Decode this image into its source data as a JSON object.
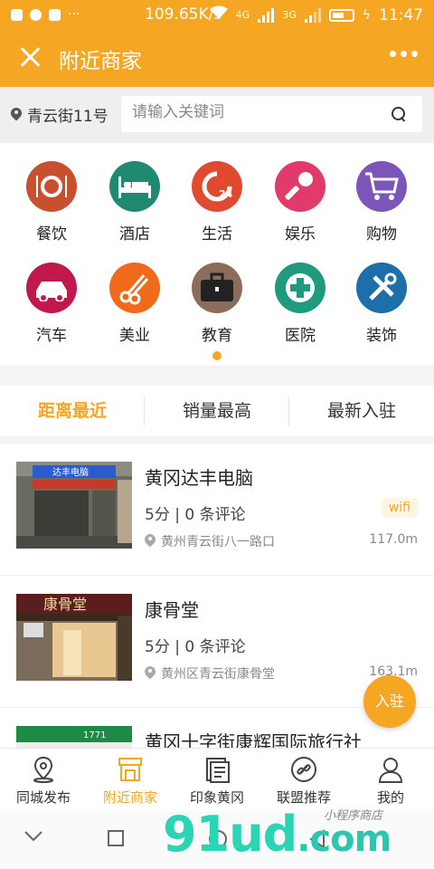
{
  "status_bar": {
    "network_speed": "109.65K/s",
    "signal_4g": "4G",
    "signal_3g": "3G",
    "time": "11:47"
  },
  "header": {
    "title": "附近商家"
  },
  "search": {
    "location": "青云街11号",
    "placeholder": "请输入关键词"
  },
  "categories": [
    {
      "label": "餐饮",
      "icon": "dining-icon",
      "color": "#c9502f"
    },
    {
      "label": "酒店",
      "icon": "hotel-bed-icon",
      "color": "#1f8a70"
    },
    {
      "label": "生活",
      "icon": "24h-service-icon",
      "color": "#e04a2f"
    },
    {
      "label": "娱乐",
      "icon": "microphone-icon",
      "color": "#e23a6a"
    },
    {
      "label": "购物",
      "icon": "shopping-cart-icon",
      "color": "#7b55b8"
    },
    {
      "label": "汽车",
      "icon": "car-icon",
      "color": "#c2194d"
    },
    {
      "label": "美业",
      "icon": "scissors-comb-icon",
      "color": "#f06a1c"
    },
    {
      "label": "教育",
      "icon": "briefcase-icon",
      "color": "#8c6d5c"
    },
    {
      "label": "医院",
      "icon": "medical-cross-icon",
      "color": "#1f9a7e"
    },
    {
      "label": "装饰",
      "icon": "tools-icon",
      "color": "#1c6fa8"
    }
  ],
  "sort_tabs": [
    {
      "label": "距离最近",
      "active": true
    },
    {
      "label": "销量最高",
      "active": false
    },
    {
      "label": "最新入驻",
      "active": false
    }
  ],
  "merchants": [
    {
      "name": "黄冈达丰电脑",
      "meta": "5分 | 0 条评论",
      "tag": "wifi",
      "address": "黄州青云街八一路口",
      "distance": "117.0m"
    },
    {
      "name": "康骨堂",
      "meta": "5分 | 0 条评论",
      "tag": "",
      "address": "黄州区青云街康骨堂",
      "distance": "163.1m"
    },
    {
      "name": "黄冈十字街康辉国际旅行社",
      "meta": "",
      "tag": "",
      "address": "",
      "distance": ""
    }
  ],
  "thumb_text": {
    "shop1_sign": "达丰电脑",
    "shop2_sign": "康骨堂",
    "shop3_sign": "1771"
  },
  "join_button": "入驻",
  "bottom_nav": [
    {
      "label": "同城发布",
      "icon": "location-pin-icon",
      "active": false
    },
    {
      "label": "附近商家",
      "icon": "storefront-icon",
      "active": true
    },
    {
      "label": "印象黄冈",
      "icon": "document-icon",
      "active": false
    },
    {
      "label": "联盟推荐",
      "icon": "link-icon",
      "active": false
    },
    {
      "label": "我的",
      "icon": "user-icon",
      "active": false
    }
  ],
  "watermark": {
    "brand": "91ud",
    "domain": ".com",
    "subtitle": "小程序商店"
  },
  "colors": {
    "accent": "#f5a623"
  }
}
